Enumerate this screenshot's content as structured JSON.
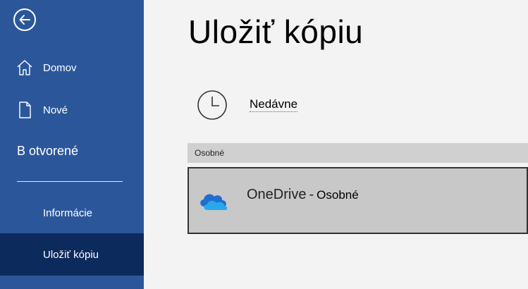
{
  "sidebar": {
    "back_label": "Back",
    "items": [
      {
        "label": "Domov",
        "icon": "home-icon"
      },
      {
        "label": "Nové",
        "icon": "new-document-icon"
      }
    ],
    "section_label": "B otvorené",
    "sub_items": [
      {
        "label": "Informácie"
      },
      {
        "label": "Uložiť kópiu",
        "active": true
      }
    ],
    "colors": {
      "background": "#2b579a",
      "active": "#0c2a5c"
    }
  },
  "main": {
    "title": "Uložiť kópiu",
    "recent": {
      "label": "Nedávne",
      "icon": "clock-icon"
    },
    "group_label": "Osobné",
    "locations": [
      {
        "name": "OneDrive",
        "separator": "-",
        "account": "Osobné",
        "icon": "onedrive-cloud-icon"
      }
    ]
  }
}
